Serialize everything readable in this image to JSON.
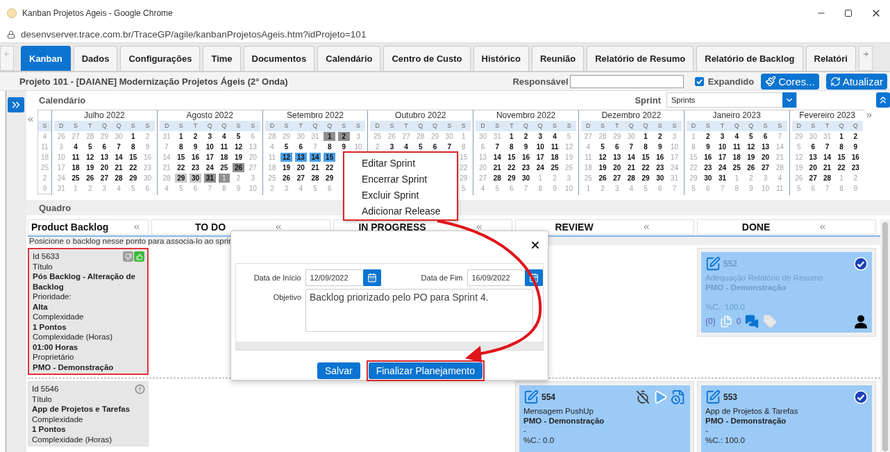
{
  "browser": {
    "title": "Kanban Projetos Ageis - Google Chrome",
    "url": "desenvserver.trace.com.br/TraceGP/agile/kanbanProjetosAgeis.htm?idProjeto=101"
  },
  "tabs": [
    {
      "label": "Kanban",
      "selected": true
    },
    {
      "label": "Dados",
      "selected": false
    },
    {
      "label": "Configurações",
      "selected": false
    },
    {
      "label": "Time",
      "selected": false
    },
    {
      "label": "Documentos",
      "selected": false
    },
    {
      "label": "Calendário",
      "selected": false
    },
    {
      "label": "Centro de Custo",
      "selected": false
    },
    {
      "label": "Histórico",
      "selected": false
    },
    {
      "label": "Reunião",
      "selected": false
    },
    {
      "label": "Relatório de Resumo",
      "selected": false
    },
    {
      "label": "Relatório de Backlog",
      "selected": false
    },
    {
      "label": "Relatóri",
      "selected": false
    }
  ],
  "project": {
    "title": "Projeto 101 - [DAIANE] Modernização Projetos Ágeis (2° Onda)",
    "owner_label": "Responsável",
    "expanded": {
      "label": "Expandido",
      "checked": true
    },
    "colors_button": "Cores...",
    "refresh_button": "Atualizar"
  },
  "calendar": {
    "title": "Calendário",
    "sprint_label": "Sprint",
    "sprint_value": "Sprints",
    "week_header": "S",
    "weeks": [
      "4",
      "11",
      "18",
      "25",
      "2",
      "9"
    ],
    "months": [
      {
        "title": "Julho 2022",
        "weekdays": [
          "D",
          "S",
          "T",
          "Q",
          "Q",
          "S",
          "S"
        ],
        "rows": [
          [
            {
              "day": "26",
              "muted": true
            },
            {
              "day": "27",
              "muted": true
            },
            {
              "day": "28",
              "muted": true
            },
            {
              "day": "29",
              "muted": true
            },
            {
              "day": "30",
              "muted": true
            },
            {
              "day": "1",
              "muted": false
            },
            {
              "day": "2",
              "muted": true
            }
          ],
          [
            {
              "day": "3",
              "muted": true
            },
            {
              "day": "4",
              "muted": false
            },
            {
              "day": "5",
              "muted": false
            },
            {
              "day": "6",
              "muted": false
            },
            {
              "day": "7",
              "muted": false
            },
            {
              "day": "8",
              "muted": false
            },
            {
              "day": "9",
              "muted": true
            }
          ],
          [
            {
              "day": "10",
              "muted": true
            },
            {
              "day": "11",
              "muted": false
            },
            {
              "day": "12",
              "muted": false
            },
            {
              "day": "13",
              "muted": false
            },
            {
              "day": "14",
              "muted": false
            },
            {
              "day": "15",
              "muted": false
            },
            {
              "day": "16",
              "muted": true
            }
          ],
          [
            {
              "day": "17",
              "muted": true
            },
            {
              "day": "18",
              "muted": false
            },
            {
              "day": "19",
              "muted": false
            },
            {
              "day": "20",
              "muted": false
            },
            {
              "day": "21",
              "muted": false
            },
            {
              "day": "22",
              "muted": false
            },
            {
              "day": "23",
              "muted": true
            }
          ],
          [
            {
              "day": "24",
              "muted": true
            },
            {
              "day": "25",
              "muted": false
            },
            {
              "day": "26",
              "muted": false
            },
            {
              "day": "27",
              "muted": false
            },
            {
              "day": "28",
              "muted": false
            },
            {
              "day": "29",
              "muted": false
            },
            {
              "day": "30",
              "muted": true
            }
          ],
          [
            {
              "day": "31",
              "muted": true
            },
            {
              "day": "1",
              "muted": true
            },
            {
              "day": "2",
              "muted": true
            },
            {
              "day": "3",
              "muted": true
            },
            {
              "day": "4",
              "muted": true
            },
            {
              "day": "5",
              "muted": true
            },
            {
              "day": "6",
              "muted": true
            }
          ]
        ]
      },
      {
        "title": "Agosto 2022",
        "weekdays": [
          "D",
          "S",
          "T",
          "Q",
          "Q",
          "S",
          "S"
        ],
        "rows": [
          [
            {
              "day": "31",
              "muted": true
            },
            {
              "day": "1",
              "muted": false
            },
            {
              "day": "2",
              "muted": false
            },
            {
              "day": "3",
              "muted": false
            },
            {
              "day": "4",
              "muted": false
            },
            {
              "day": "5",
              "muted": false
            },
            {
              "day": "6",
              "muted": true
            }
          ],
          [
            {
              "day": "7",
              "muted": true
            },
            {
              "day": "8",
              "muted": false
            },
            {
              "day": "9",
              "muted": false
            },
            {
              "day": "10",
              "muted": false
            },
            {
              "day": "11",
              "muted": false
            },
            {
              "day": "12",
              "muted": false
            },
            {
              "day": "13",
              "muted": true
            }
          ],
          [
            {
              "day": "14",
              "muted": true
            },
            {
              "day": "15",
              "muted": false
            },
            {
              "day": "16",
              "muted": false
            },
            {
              "day": "17",
              "muted": false
            },
            {
              "day": "18",
              "muted": false
            },
            {
              "day": "19",
              "muted": false
            },
            {
              "day": "20",
              "muted": true
            }
          ],
          [
            {
              "day": "21",
              "muted": true
            },
            {
              "day": "22",
              "muted": false
            },
            {
              "day": "23",
              "muted": false
            },
            {
              "day": "24",
              "muted": false
            },
            {
              "day": "25",
              "muted": false
            },
            {
              "day": "26",
              "muted": false,
              "color": "#909090"
            },
            {
              "day": "27",
              "muted": true
            }
          ],
          [
            {
              "day": "28",
              "muted": true
            },
            {
              "day": "29",
              "muted": false,
              "color": "#c9c9c9"
            },
            {
              "day": "30",
              "muted": false,
              "color": "#c9c9c9"
            },
            {
              "day": "31",
              "muted": false,
              "color": "#909090"
            },
            {
              "day": "1",
              "muted": true,
              "color": "#909090"
            },
            {
              "day": "2",
              "muted": true
            },
            {
              "day": "3",
              "muted": true
            }
          ],
          [
            {
              "day": "4",
              "muted": true
            },
            {
              "day": "5",
              "muted": true
            },
            {
              "day": "6",
              "muted": true
            },
            {
              "day": "7",
              "muted": true
            },
            {
              "day": "8",
              "muted": true
            },
            {
              "day": "9",
              "muted": true
            },
            {
              "day": "10",
              "muted": true
            }
          ]
        ]
      },
      {
        "title": "Setembro 2022",
        "weekdays": [
          "D",
          "S",
          "T",
          "Q",
          "Q",
          "S",
          "S"
        ],
        "rows": [
          [
            {
              "day": "28",
              "muted": true
            },
            {
              "day": "29",
              "muted": true
            },
            {
              "day": "30",
              "muted": true
            },
            {
              "day": "31",
              "muted": true
            },
            {
              "day": "1",
              "muted": false,
              "color": "#909090"
            },
            {
              "day": "2",
              "muted": false,
              "color": "#909090"
            },
            {
              "day": "3",
              "muted": true
            }
          ],
          [
            {
              "day": "4",
              "muted": true
            },
            {
              "day": "5",
              "muted": false
            },
            {
              "day": "6",
              "muted": false
            },
            {
              "day": "7",
              "muted": true
            },
            {
              "day": "8",
              "muted": false
            },
            {
              "day": "9",
              "muted": false
            },
            {
              "day": "10",
              "muted": true
            }
          ],
          [
            {
              "day": "11",
              "muted": true
            },
            {
              "day": "12",
              "muted": false,
              "color": "#4aa0e8"
            },
            {
              "day": "13",
              "muted": false,
              "color": "#4aa0e8"
            },
            {
              "day": "14",
              "muted": false,
              "color": "#4aa0e8"
            },
            {
              "day": "15",
              "muted": false,
              "color": "#4aa0e8"
            },
            null,
            null
          ],
          [
            {
              "day": "18",
              "muted": true
            },
            {
              "day": "19",
              "muted": false
            },
            {
              "day": "20",
              "muted": false
            },
            {
              "day": "21",
              "muted": false
            },
            {
              "day": "22",
              "muted": false
            },
            null,
            null
          ],
          [
            {
              "day": "25",
              "muted": true
            },
            {
              "day": "26",
              "muted": false
            },
            {
              "day": "27",
              "muted": false
            },
            {
              "day": "28",
              "muted": false
            },
            {
              "day": "29",
              "muted": false
            },
            null,
            null
          ],
          [
            {
              "day": "2",
              "muted": true
            },
            {
              "day": "3",
              "muted": true
            },
            {
              "day": "4",
              "muted": true
            },
            {
              "day": "5",
              "muted": true
            },
            {
              "day": "6",
              "muted": true
            },
            null,
            null
          ]
        ]
      },
      {
        "title": "Outubro 2022",
        "weekdays": [
          "D",
          "S",
          "T",
          "Q",
          "Q",
          "S",
          "S"
        ],
        "rows": [
          [
            {
              "day": "25",
              "muted": true
            },
            {
              "day": "26",
              "muted": true
            },
            {
              "day": "27",
              "muted": true
            },
            {
              "day": "28",
              "muted": true
            },
            {
              "day": "29",
              "muted": true
            },
            {
              "day": "30",
              "muted": true
            },
            {
              "day": "1",
              "muted": true
            }
          ],
          [
            {
              "day": "2",
              "muted": true
            },
            {
              "day": "3",
              "muted": false
            },
            {
              "day": "4",
              "muted": false
            },
            {
              "day": "5",
              "muted": false
            },
            {
              "day": "6",
              "muted": false
            },
            {
              "day": "7",
              "muted": false
            },
            {
              "day": "8",
              "muted": true
            }
          ],
          [
            null,
            null,
            null,
            null,
            null,
            null,
            {
              "day": "15",
              "muted": true
            }
          ],
          [
            null,
            null,
            null,
            null,
            null,
            null,
            {
              "day": "22",
              "muted": true
            }
          ],
          [
            null,
            null,
            null,
            null,
            null,
            null,
            {
              "day": "29",
              "muted": true
            }
          ],
          [
            null,
            null,
            null,
            null,
            null,
            null,
            {
              "day": "5",
              "muted": true
            }
          ]
        ]
      },
      {
        "title": "Novembro 2022",
        "weekdays": [
          "D",
          "S",
          "T",
          "Q",
          "Q",
          "S",
          "S"
        ],
        "rows": [
          [
            {
              "day": "30",
              "muted": true
            },
            {
              "day": "31",
              "muted": true
            },
            {
              "day": "1",
              "muted": false
            },
            {
              "day": "2",
              "muted": false
            },
            {
              "day": "3",
              "muted": false
            },
            {
              "day": "4",
              "muted": false
            },
            {
              "day": "5",
              "muted": true
            }
          ],
          [
            {
              "day": "6",
              "muted": true
            },
            {
              "day": "7",
              "muted": false
            },
            {
              "day": "8",
              "muted": false
            },
            {
              "day": "9",
              "muted": false
            },
            {
              "day": "10",
              "muted": false
            },
            {
              "day": "11",
              "muted": false
            },
            {
              "day": "12",
              "muted": true
            }
          ],
          [
            {
              "day": "13",
              "muted": true
            },
            {
              "day": "14",
              "muted": false
            },
            {
              "day": "15",
              "muted": false
            },
            {
              "day": "16",
              "muted": false
            },
            {
              "day": "17",
              "muted": false
            },
            {
              "day": "18",
              "muted": false
            },
            {
              "day": "19",
              "muted": true
            }
          ],
          [
            {
              "day": "20",
              "muted": true
            },
            {
              "day": "21",
              "muted": false
            },
            {
              "day": "22",
              "muted": false
            },
            {
              "day": "23",
              "muted": false
            },
            {
              "day": "24",
              "muted": false
            },
            {
              "day": "25",
              "muted": false
            },
            {
              "day": "26",
              "muted": true
            }
          ],
          [
            {
              "day": "27",
              "muted": true
            },
            {
              "day": "28",
              "muted": false
            },
            {
              "day": "29",
              "muted": false
            },
            {
              "day": "30",
              "muted": false
            },
            {
              "day": "1",
              "muted": true
            },
            {
              "day": "2",
              "muted": true
            },
            {
              "day": "3",
              "muted": true
            }
          ],
          [
            {
              "day": "4",
              "muted": true
            },
            {
              "day": "5",
              "muted": true
            },
            {
              "day": "6",
              "muted": true
            },
            {
              "day": "7",
              "muted": true
            },
            {
              "day": "8",
              "muted": true
            },
            {
              "day": "9",
              "muted": true
            },
            {
              "day": "10",
              "muted": true
            }
          ]
        ]
      },
      {
        "title": "Dezembro 2022",
        "weekdays": [
          "D",
          "S",
          "T",
          "Q",
          "Q",
          "S",
          "S"
        ],
        "rows": [
          [
            {
              "day": "27",
              "muted": true
            },
            {
              "day": "28",
              "muted": true
            },
            {
              "day": "29",
              "muted": true
            },
            {
              "day": "30",
              "muted": true
            },
            {
              "day": "1",
              "muted": false
            },
            {
              "day": "2",
              "muted": false
            },
            {
              "day": "3",
              "muted": true
            }
          ],
          [
            {
              "day": "4",
              "muted": true
            },
            {
              "day": "5",
              "muted": false
            },
            {
              "day": "6",
              "muted": false
            },
            {
              "day": "7",
              "muted": false
            },
            {
              "day": "8",
              "muted": false
            },
            {
              "day": "9",
              "muted": false
            },
            {
              "day": "10",
              "muted": true
            }
          ],
          [
            {
              "day": "11",
              "muted": true
            },
            {
              "day": "12",
              "muted": false
            },
            {
              "day": "13",
              "muted": false
            },
            {
              "day": "14",
              "muted": false
            },
            {
              "day": "15",
              "muted": false
            },
            {
              "day": "16",
              "muted": false
            },
            {
              "day": "17",
              "muted": true
            }
          ],
          [
            {
              "day": "18",
              "muted": true
            },
            {
              "day": "19",
              "muted": false
            },
            {
              "day": "20",
              "muted": false
            },
            {
              "day": "21",
              "muted": false
            },
            {
              "day": "22",
              "muted": false
            },
            {
              "day": "23",
              "muted": false
            },
            {
              "day": "24",
              "muted": true
            }
          ],
          [
            {
              "day": "25",
              "muted": true
            },
            {
              "day": "26",
              "muted": false
            },
            {
              "day": "27",
              "muted": false
            },
            {
              "day": "28",
              "muted": false
            },
            {
              "day": "29",
              "muted": false
            },
            {
              "day": "30",
              "muted": false
            },
            {
              "day": "31",
              "muted": true
            }
          ],
          [
            {
              "day": "1",
              "muted": true
            },
            {
              "day": "2",
              "muted": true
            },
            {
              "day": "3",
              "muted": true
            },
            {
              "day": "4",
              "muted": true
            },
            {
              "day": "5",
              "muted": true
            },
            {
              "day": "6",
              "muted": true
            },
            {
              "day": "7",
              "muted": true
            }
          ]
        ]
      },
      {
        "title": "Janeiro 2023",
        "weekdays": [
          "D",
          "S",
          "T",
          "Q",
          "Q",
          "S",
          "S"
        ],
        "rows": [
          [
            {
              "day": "1",
              "muted": true
            },
            {
              "day": "2",
              "muted": false
            },
            {
              "day": "3",
              "muted": false
            },
            {
              "day": "4",
              "muted": false
            },
            {
              "day": "5",
              "muted": false
            },
            {
              "day": "6",
              "muted": false
            },
            {
              "day": "7",
              "muted": true
            }
          ],
          [
            {
              "day": "8",
              "muted": true
            },
            {
              "day": "9",
              "muted": false
            },
            {
              "day": "10",
              "muted": false
            },
            {
              "day": "11",
              "muted": false
            },
            {
              "day": "12",
              "muted": false
            },
            {
              "day": "13",
              "muted": false
            },
            {
              "day": "14",
              "muted": true
            }
          ],
          [
            {
              "day": "15",
              "muted": true
            },
            {
              "day": "16",
              "muted": false
            },
            {
              "day": "17",
              "muted": false
            },
            {
              "day": "18",
              "muted": false
            },
            {
              "day": "19",
              "muted": false
            },
            {
              "day": "20",
              "muted": false
            },
            {
              "day": "21",
              "muted": true
            }
          ],
          [
            {
              "day": "22",
              "muted": true
            },
            {
              "day": "23",
              "muted": false
            },
            {
              "day": "24",
              "muted": false
            },
            {
              "day": "25",
              "muted": false
            },
            {
              "day": "26",
              "muted": false
            },
            {
              "day": "27",
              "muted": false
            },
            {
              "day": "28",
              "muted": true
            }
          ],
          [
            {
              "day": "29",
              "muted": true
            },
            {
              "day": "30",
              "muted": false
            },
            {
              "day": "31",
              "muted": false
            },
            {
              "day": "1",
              "muted": true
            },
            {
              "day": "2",
              "muted": true
            },
            {
              "day": "3",
              "muted": true
            },
            {
              "day": "4",
              "muted": true
            }
          ],
          [
            {
              "day": "5",
              "muted": true
            },
            {
              "day": "6",
              "muted": true
            },
            {
              "day": "7",
              "muted": true
            },
            {
              "day": "8",
              "muted": true
            },
            {
              "day": "9",
              "muted": true
            },
            {
              "day": "10",
              "muted": true
            },
            {
              "day": "11",
              "muted": true
            }
          ]
        ]
      },
      {
        "title": "Fevereiro 2023",
        "weekdays": [
          "D",
          "S",
          "T",
          "Q",
          "Q"
        ],
        "rows": [
          [
            {
              "day": "29",
              "muted": true
            },
            {
              "day": "30",
              "muted": true
            },
            {
              "day": "31",
              "muted": true
            },
            {
              "day": "1",
              "muted": false
            },
            {
              "day": "2",
              "muted": false
            }
          ],
          [
            {
              "day": "5",
              "muted": true
            },
            {
              "day": "6",
              "muted": false
            },
            {
              "day": "7",
              "muted": false
            },
            {
              "day": "8",
              "muted": false
            },
            {
              "day": "9",
              "muted": false
            }
          ],
          [
            {
              "day": "12",
              "muted": true
            },
            {
              "day": "13",
              "muted": false
            },
            {
              "day": "14",
              "muted": false
            },
            {
              "day": "15",
              "muted": false
            },
            {
              "day": "16",
              "muted": false
            }
          ],
          [
            {
              "day": "19",
              "muted": true
            },
            {
              "day": "20",
              "muted": false
            },
            {
              "day": "21",
              "muted": false
            },
            {
              "day": "22",
              "muted": false
            },
            {
              "day": "23",
              "muted": false
            }
          ],
          [
            {
              "day": "26",
              "muted": true
            },
            {
              "day": "27",
              "muted": false
            },
            {
              "day": "28",
              "muted": false
            },
            {
              "day": "1",
              "muted": true
            },
            {
              "day": "2",
              "muted": true
            }
          ],
          [
            {
              "day": "5",
              "muted": true
            },
            {
              "day": "6",
              "muted": true
            },
            {
              "day": "7",
              "muted": true
            },
            {
              "day": "8",
              "muted": true
            },
            {
              "day": "9",
              "muted": true
            }
          ]
        ]
      }
    ]
  },
  "context_menu": {
    "items": [
      "Editar Sprint",
      "Encerrar Sprint",
      "Excluir Sprint",
      "Adicionar Release"
    ]
  },
  "board": {
    "title": "Quadro",
    "backlog_title": "Product Backlog",
    "columns": [
      "TO DO",
      "IN PROGRESS",
      "REVIEW",
      "DONE"
    ],
    "notice": "Posicione o backlog nesse ponto para associa-lo ao sprir",
    "rows": [
      {
        "backlog": {
          "id": "Id 5633",
          "outlined": true,
          "kind": "votes",
          "lines": [
            {
              "text": "Título",
              "bold": false
            },
            {
              "text": "Pós Backlog - Alteração de Backlog",
              "bold": true
            },
            {
              "text": "Prioridade:",
              "bold": false
            },
            {
              "text": "Alta",
              "bold": true
            },
            {
              "text": "Complexidade",
              "bold": false
            },
            {
              "text": "1 Pontos",
              "bold": true
            },
            {
              "text": "Complexidade (Horas)",
              "bold": false
            },
            {
              "text": "01:00 Horas",
              "bold": true
            },
            {
              "text": "Proprietário",
              "bold": false
            },
            {
              "text": "PMO - Demonstração",
              "bold": true
            }
          ]
        },
        "cells": [
          null,
          null,
          null,
          {
            "id": "552",
            "title": "Adequação Relatório de Resumo",
            "owner": "PMO - Demonstração",
            "percent": "%C.: 100.0",
            "faded": true,
            "kind": "done",
            "footer": {
              "attachments": "(0)",
              "comments": "0"
            }
          }
        ]
      },
      {
        "backlog": {
          "id": "Id 5546",
          "outlined": false,
          "kind": "alert",
          "lines": [
            {
              "text": "Título",
              "bold": false
            },
            {
              "text": "App de Projetos e Tarefas",
              "bold": true
            },
            {
              "text": "Complexidade",
              "bold": false
            },
            {
              "text": "1 Pontos",
              "bold": true
            },
            {
              "text": "Complexidade (Horas)",
              "bold": false
            }
          ]
        },
        "cells": [
          null,
          null,
          {
            "id": "554",
            "title": "Mensagem PushUp",
            "owner": "PMO - Demonstração",
            "separator": "-",
            "percent": "%C.: 0.0",
            "faded": false,
            "kind": "active"
          },
          {
            "id": "553",
            "title": "App de Projetos & Tarefas",
            "owner": "PMO - Demonstração",
            "separator": "-",
            "percent": "%C.: 100.0",
            "faded": false,
            "kind": "done"
          }
        ]
      }
    ]
  },
  "dialog": {
    "start_label": "Data de Início",
    "start_value": "12/09/2022",
    "end_label": "Data de Fim",
    "end_value": "16/09/2022",
    "goal_label": "Objetivo",
    "goal_value": "Backlog priorizado pelo PO para Sprint 4.",
    "buttons": [
      {
        "label": "Salvar",
        "highlighted": false
      },
      {
        "label": "Finalizar Planejamento",
        "highlighted": true
      }
    ]
  }
}
